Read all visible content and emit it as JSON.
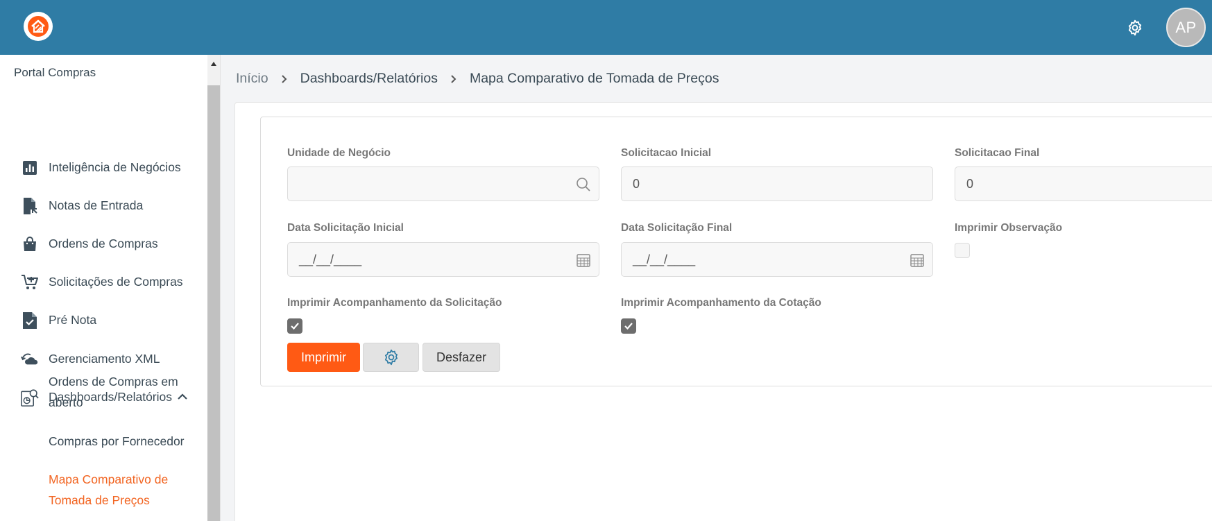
{
  "header": {
    "logo_icon": "house-logo-icon",
    "settings_icon": "gear-icon",
    "avatar_initials": "AP",
    "brand_color": "#2f7ca5",
    "accent_color": "#ff5a14"
  },
  "sidebar": {
    "title": "Portal Compras",
    "items": [
      {
        "label": "Inteligência de Negócios",
        "icon": "bar-chart-icon"
      },
      {
        "label": "Notas de Entrada",
        "icon": "document-arrow-icon"
      },
      {
        "label": "Ordens de Compras",
        "icon": "shopping-bag-icon"
      },
      {
        "label": "Solicitações de Compras",
        "icon": "cart-add-icon"
      },
      {
        "label": "Pré Nota",
        "icon": "document-check-icon"
      },
      {
        "label": "Gerenciamento XML",
        "icon": "cloud-sync-icon"
      },
      {
        "label": "Dashboards/Relatórios",
        "icon": "report-search-icon",
        "expanded": true
      }
    ],
    "subitems": [
      {
        "label": "Ordens de Compras em aberto"
      },
      {
        "label": "Compras por Fornecedor"
      },
      {
        "label": "Mapa Comparativo de Tomada de Preços",
        "active": true
      }
    ]
  },
  "breadcrumb": {
    "items": [
      "Início",
      "Dashboards/Relatórios",
      "Mapa Comparativo de Tomada de Preços"
    ]
  },
  "form": {
    "unidade_negocio": {
      "label": "Unidade de Negócio",
      "value": ""
    },
    "solicitacao_inicial": {
      "label": "Solicitacao Inicial",
      "value": "0"
    },
    "solicitacao_final": {
      "label": "Solicitacao Final",
      "value": "0"
    },
    "data_solicitacao_inicial": {
      "label": "Data Solicitação Inicial",
      "value": "__/__/____"
    },
    "data_solicitacao_final": {
      "label": "Data Solicitação Final",
      "value": "__/__/____"
    },
    "imprimir_observacao": {
      "label": "Imprimir Observação",
      "checked": false
    },
    "imprimir_acomp_solicitacao": {
      "label": "Imprimir Acompanhamento da Solicitação",
      "checked": true
    },
    "imprimir_acomp_cotacao": {
      "label": "Imprimir Acompanhamento da Cotação",
      "checked": true
    }
  },
  "actions": {
    "print_label": "Imprimir",
    "settings_icon": "gear-icon",
    "undo_label": "Desfazer"
  }
}
